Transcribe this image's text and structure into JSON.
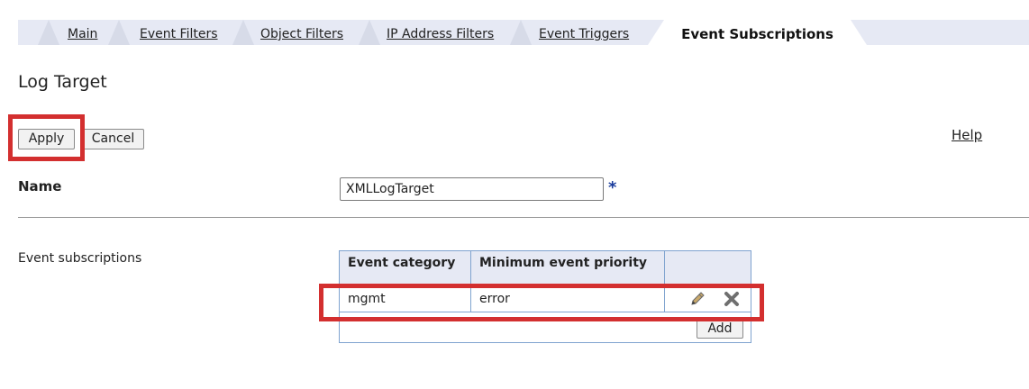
{
  "tabs": [
    {
      "label": "Main"
    },
    {
      "label": "Event Filters"
    },
    {
      "label": "Object Filters"
    },
    {
      "label": "IP Address Filters"
    },
    {
      "label": "Event Triggers"
    },
    {
      "label": "Event Subscriptions",
      "active": true
    }
  ],
  "page": {
    "title": "Log Target"
  },
  "toolbar": {
    "apply_label": "Apply",
    "cancel_label": "Cancel",
    "help_label": "Help"
  },
  "name_field": {
    "label": "Name",
    "value": "XMLLogTarget",
    "required_marker": "*"
  },
  "event_subscriptions": {
    "label": "Event subscriptions",
    "columns": [
      "Event category",
      "Minimum event priority",
      ""
    ],
    "rows": [
      {
        "category": "mgmt",
        "priority": "error"
      }
    ],
    "add_label": "Add"
  },
  "icons": {
    "edit": "pencil-icon",
    "delete": "delete-x-icon"
  },
  "colors": {
    "highlight": "#d32f2f",
    "tab_bar": "#e6e9f4",
    "table_border": "#7fa3cf",
    "required_star": "#1a3c9c"
  }
}
